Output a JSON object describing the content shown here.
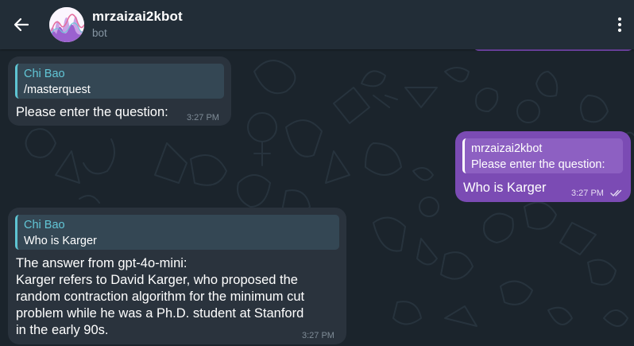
{
  "header": {
    "title": "mrzaizai2kbot",
    "subtitle": "bot"
  },
  "messages": [
    {
      "direction": "incoming",
      "reply_name": "Chi Bao",
      "reply_text": "/masterquest",
      "text": "Please enter the question:",
      "time": "3:27 PM"
    },
    {
      "direction": "outgoing",
      "reply_name": "mrzaizai2kbot",
      "reply_text": "Please enter the question:",
      "text": "Who is Karger",
      "time": "3:27 PM",
      "status": "read"
    },
    {
      "direction": "incoming",
      "reply_name": "Chi Bao",
      "reply_text": "Who is Karger",
      "text_lines": [
        "The answer from gpt-4o-mini:",
        "Karger refers to David Karger, who proposed the",
        "random contraction algorithm for the minimum cut",
        "problem while he was a Ph.D. student at Stanford",
        "in the early 90s."
      ],
      "time": "3:27 PM"
    }
  ],
  "icons": {
    "back": "arrow-left-icon",
    "more": "vertical-ellipsis-icon",
    "read_status": "double-check-icon"
  },
  "colors": {
    "header_bg": "#222d37",
    "chat_bg": "#1b242c",
    "incoming_bubble": "#2a333d",
    "outgoing_bubble": "#7b4bb4",
    "reply_accent_in": "#5ec4d2",
    "secondary_text": "#8696a3"
  }
}
